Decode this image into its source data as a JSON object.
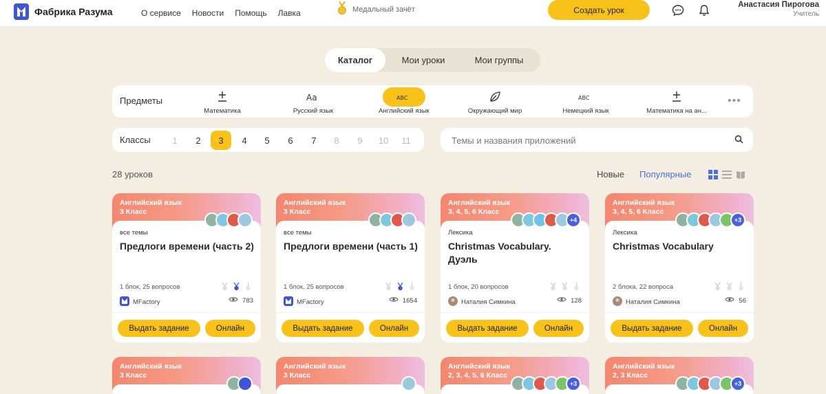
{
  "header": {
    "brand": "Фабрика Разума",
    "nav": [
      "О сервисе",
      "Новости",
      "Помощь",
      "Лавка"
    ],
    "medal_text": "Медальный зачёт",
    "create_label": "Создать урок",
    "user_name": "Анастасия Пирогова",
    "user_role": "Учитель"
  },
  "tabs": [
    "Каталог",
    "Мои уроки",
    "Мои группы"
  ],
  "subjects": {
    "label": "Предметы",
    "items": [
      {
        "name": "Математика",
        "icon": "plus-minus-icon"
      },
      {
        "name": "Русский язык",
        "icon": "aa-icon"
      },
      {
        "name": "Английский язык",
        "icon": "abc-icon"
      },
      {
        "name": "Окружающий мир",
        "icon": "leaf-icon"
      },
      {
        "name": "Немецкий язык",
        "icon": "abc-icon"
      },
      {
        "name": "Математика на ан...",
        "icon": "plus-minus-icon"
      }
    ],
    "active": "Английский язык"
  },
  "grades": {
    "label": "Классы",
    "items": [
      "1",
      "2",
      "3",
      "4",
      "5",
      "6",
      "7",
      "8",
      "9",
      "10",
      "11"
    ],
    "active": "3"
  },
  "search": {
    "placeholder": "Темы и названия приложений"
  },
  "count_text": "28 уроков",
  "sort": {
    "new": "Новые",
    "popular": "Популярные"
  },
  "cards": [
    {
      "subject": "Английский язык",
      "grades": "3 Класс",
      "topic": "все темы",
      "title": "Предлоги времени (часть 2)",
      "meta": "1 блок, 25 вопросов",
      "author": "MFactory",
      "views": "783",
      "more": "",
      "btn_assign": "Выдать задание",
      "btn_online": "Онлайн"
    },
    {
      "subject": "Английский язык",
      "grades": "3 Класс",
      "topic": "все темы",
      "title": "Предлоги времени (часть 1)",
      "meta": "1 блок, 25 вопросов",
      "author": "MFactory",
      "views": "1654",
      "more": "",
      "btn_assign": "Выдать задание",
      "btn_online": "Онлайн"
    },
    {
      "subject": "Английский язык",
      "grades": "3, 4, 5, 6 Класс",
      "topic": "Лексика",
      "title": "Christmas Vocabulary. Дуэль",
      "meta": "1 блок, 20 вопросов",
      "author": "Наталия Симкина",
      "views": "128",
      "more": "+4",
      "btn_assign": "Выдать задание",
      "btn_online": "Онлайн"
    },
    {
      "subject": "Английский язык",
      "grades": "3, 4, 5, 6 Класс",
      "topic": "Лексика",
      "title": "Christmas Vocabulary",
      "meta": "2 блока, 22 вопроса",
      "author": "Наталия Симкина",
      "views": "56",
      "more": "+3",
      "btn_assign": "Выдать задание",
      "btn_online": "Онлайн"
    }
  ],
  "cards_row2": [
    {
      "subject": "Английский язык",
      "grades": "3 Класс",
      "more": ""
    },
    {
      "subject": "Английский язык",
      "grades": "3 Класс",
      "more": ""
    },
    {
      "subject": "Английский язык",
      "grades": "2, 3, 4, 5, 6 Класс",
      "more": "+3"
    },
    {
      "subject": "Английский язык",
      "grades": "2, 3 Класс",
      "more": "+3"
    }
  ],
  "colors": {
    "accent": "#f8c21a",
    "link": "#4a6fe0",
    "background": "#f3eee1",
    "more_badge": "#4a5fe0"
  }
}
